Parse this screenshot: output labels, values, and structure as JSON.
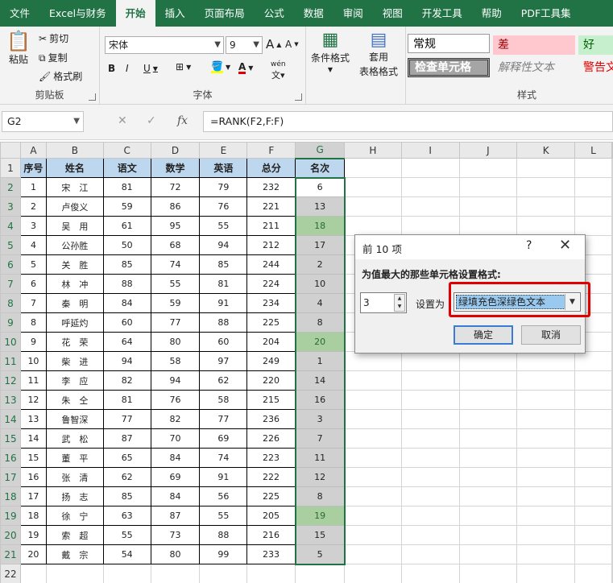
{
  "tabs": [
    "文件",
    "Excel与财务",
    "开始",
    "插入",
    "页面布局",
    "公式",
    "数据",
    "审阅",
    "视图",
    "开发工具",
    "帮助",
    "PDF工具集"
  ],
  "active_tab": "开始",
  "ribbon": {
    "clipboard": {
      "paste": "粘贴",
      "cut": "剪切",
      "copy": "复制",
      "format_painter": "格式刷",
      "label": "剪贴板"
    },
    "font": {
      "name": "宋体",
      "size": "9",
      "label": "字体",
      "bold": "B",
      "italic": "I",
      "underline": "U",
      "grow": "A",
      "shrink": "A",
      "wen": "wén"
    },
    "cond_format": {
      "l1": "条件格式",
      "l2": "套用",
      "l3": "表格格式"
    },
    "styles": {
      "normal": "常规",
      "bad": "差",
      "good": "好",
      "check": "检查单元格",
      "explain": "解释性文本",
      "warn": "警告文",
      "label": "样式"
    }
  },
  "formula_bar": {
    "cell": "G2",
    "fx": "fx",
    "formula": "=RANK(F2,F:F)"
  },
  "columns": [
    "A",
    "B",
    "C",
    "D",
    "E",
    "F",
    "G",
    "H",
    "I",
    "J",
    "K",
    "L"
  ],
  "header_row": [
    "序号",
    "姓名",
    "语文",
    "数学",
    "英语",
    "总分",
    "名次"
  ],
  "rows": [
    [
      "1",
      "宋　江",
      "81",
      "72",
      "79",
      "232",
      "6"
    ],
    [
      "2",
      "卢俊义",
      "59",
      "86",
      "76",
      "221",
      "13"
    ],
    [
      "3",
      "吴　用",
      "61",
      "95",
      "55",
      "211",
      "18"
    ],
    [
      "4",
      "公孙胜",
      "50",
      "68",
      "94",
      "212",
      "17"
    ],
    [
      "5",
      "关　胜",
      "85",
      "74",
      "85",
      "244",
      "2"
    ],
    [
      "6",
      "林　冲",
      "88",
      "55",
      "81",
      "224",
      "10"
    ],
    [
      "7",
      "秦　明",
      "84",
      "59",
      "91",
      "234",
      "4"
    ],
    [
      "8",
      "呼延灼",
      "60",
      "77",
      "88",
      "225",
      "8"
    ],
    [
      "9",
      "花　荣",
      "64",
      "80",
      "60",
      "204",
      "20"
    ],
    [
      "10",
      "柴　进",
      "94",
      "58",
      "97",
      "249",
      "1"
    ],
    [
      "11",
      "李　应",
      "82",
      "94",
      "62",
      "220",
      "14"
    ],
    [
      "12",
      "朱　仝",
      "81",
      "76",
      "58",
      "215",
      "16"
    ],
    [
      "13",
      "鲁智深",
      "77",
      "82",
      "77",
      "236",
      "3"
    ],
    [
      "14",
      "武　松",
      "87",
      "70",
      "69",
      "226",
      "7"
    ],
    [
      "15",
      "董　平",
      "65",
      "84",
      "74",
      "223",
      "11"
    ],
    [
      "16",
      "张　清",
      "62",
      "69",
      "91",
      "222",
      "12"
    ],
    [
      "17",
      "扬　志",
      "85",
      "84",
      "56",
      "225",
      "8"
    ],
    [
      "18",
      "徐　宁",
      "63",
      "87",
      "55",
      "205",
      "19"
    ],
    [
      "19",
      "索　超",
      "55",
      "73",
      "88",
      "216",
      "15"
    ],
    [
      "20",
      "戴　宗",
      "54",
      "80",
      "99",
      "233",
      "5"
    ]
  ],
  "highlight_ranks": [
    "18",
    "20",
    "19"
  ],
  "dialog": {
    "title": "前 10 项",
    "help": "?",
    "close": "✕",
    "message": "为值最大的那些单元格设置格式:",
    "count": "3",
    "set_as": "设置为",
    "format": "绿填充色深绿色文本",
    "ok": "确定",
    "cancel": "取消"
  },
  "colors": {
    "accent": "#217346",
    "header_fill": "#bdd7ee",
    "highlight_fill": "#a9cfa1",
    "highlight_text": "#2a6b2a",
    "red_box": "#e00000"
  }
}
